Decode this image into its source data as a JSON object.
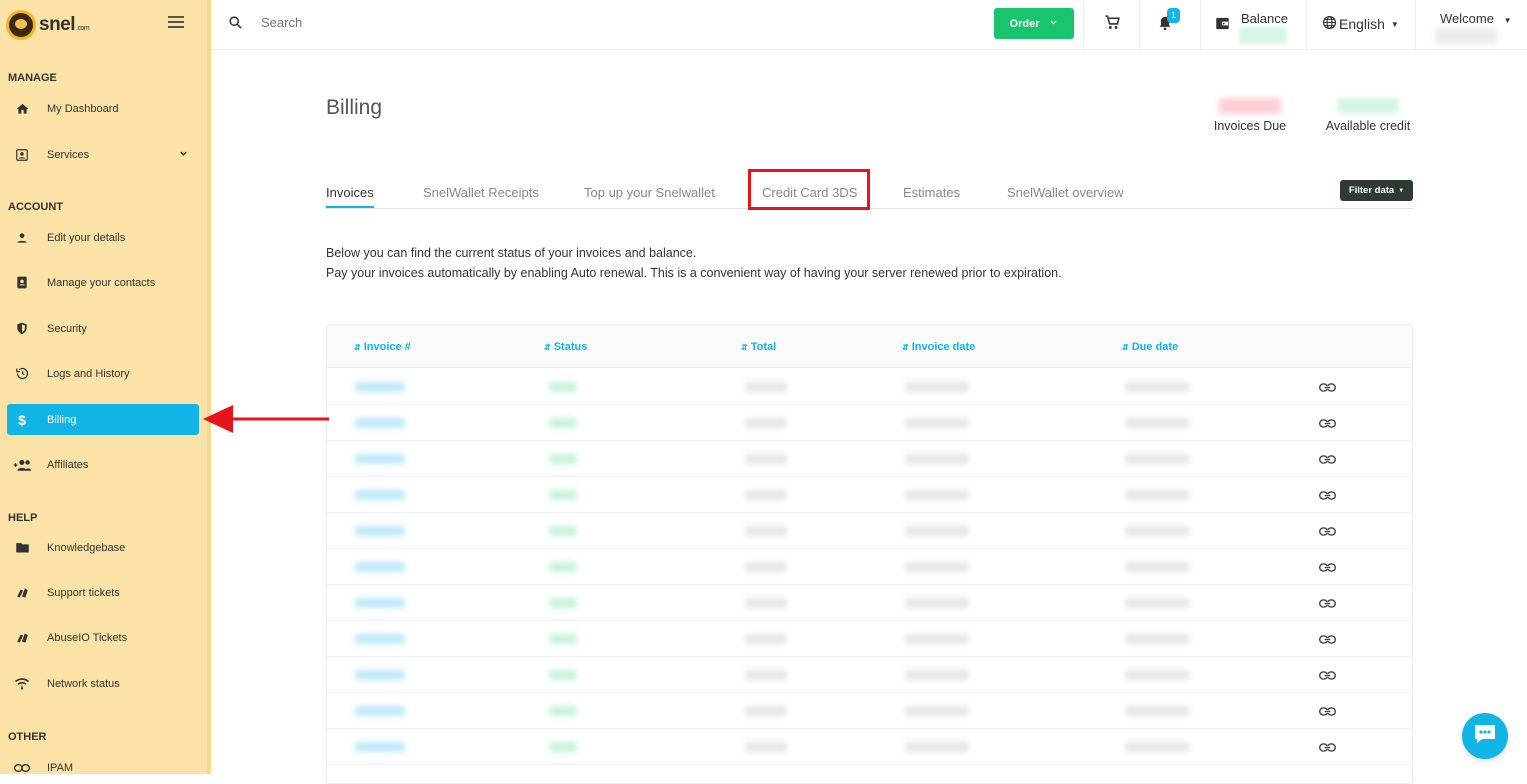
{
  "brand": {
    "name": "snel",
    "suffix": ".com"
  },
  "sidebar": {
    "sections": [
      {
        "label": "MANAGE",
        "items": [
          {
            "label": "My Dashboard",
            "icon": "home-icon"
          },
          {
            "label": "Services",
            "icon": "portrait-icon",
            "has_chevron": true
          }
        ]
      },
      {
        "label": "ACCOUNT",
        "items": [
          {
            "label": "Edit your details",
            "icon": "person-icon"
          },
          {
            "label": "Manage your contacts",
            "icon": "contacts-icon"
          },
          {
            "label": "Security",
            "icon": "shield-icon"
          },
          {
            "label": "Logs and History",
            "icon": "history-icon"
          },
          {
            "label": "Billing",
            "icon": "dollar-icon",
            "active": true
          },
          {
            "label": "Affiliates",
            "icon": "group-add-icon"
          }
        ]
      },
      {
        "label": "HELP",
        "items": [
          {
            "label": "Knowledgebase",
            "icon": "folder-icon"
          },
          {
            "label": "Support tickets",
            "icon": "tickets-icon"
          },
          {
            "label": "AbuseIO Tickets",
            "icon": "tickets-icon"
          },
          {
            "label": "Network status",
            "icon": "network-icon"
          }
        ]
      },
      {
        "label": "OTHER",
        "items": [
          {
            "label": "IPAM",
            "icon": "link-icon"
          }
        ]
      }
    ]
  },
  "topbar": {
    "search_placeholder": "Search",
    "order_label": "Order",
    "notification_count": "1",
    "balance_label": "Balance",
    "language": "English",
    "welcome_label": "Welcome"
  },
  "billing": {
    "title": "Billing",
    "invoices_due_label": "Invoices Due",
    "available_credit_label": "Available credit",
    "tabs": [
      {
        "label": "Invoices",
        "active": true
      },
      {
        "label": "SnelWallet Receipts"
      },
      {
        "label": "Top up your Snelwallet"
      },
      {
        "label": "Credit Card 3DS",
        "highlighted": true
      },
      {
        "label": "Estimates"
      },
      {
        "label": "SnelWallet overview"
      }
    ],
    "filter_label": "Filter data",
    "intro_line1": "Below you can find the current status of your invoices and balance.",
    "intro_line2": "Pay your invoices automatically by enabling Auto renewal. This is a convenient way of having your server renewed prior to expiration.",
    "columns": [
      "Invoice #",
      "Status",
      "Total",
      "Invoice date",
      "Due date"
    ],
    "row_count": 11
  },
  "colors": {
    "sidebar_bg": "#fbe3a7",
    "accent": "#11b5e5",
    "order_green": "#18c56c",
    "annotation_red": "#e8141c"
  }
}
